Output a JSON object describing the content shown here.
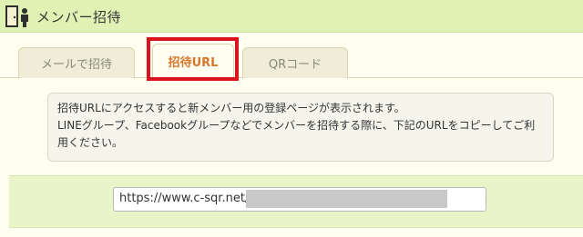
{
  "header": {
    "title": "メンバー招待",
    "icon": "door-person-icon"
  },
  "tabs": [
    {
      "label": "メールで招待",
      "active": false
    },
    {
      "label": "招待URL",
      "active": true
    },
    {
      "label": "QRコード",
      "active": false
    }
  ],
  "info": {
    "line1": "招待URLにアクセスすると新メンバー用の登録ページが表示されます。",
    "line2": "LINEグループ、Facebookグループなどでメンバーを招待する際に、下記のURLをコピーしてご利",
    "line3": "用ください。"
  },
  "invite_url": {
    "visible_text": "https://www.c-sqr.net/?"
  },
  "colors": {
    "header_bg": "#dff2b4",
    "active_tab_text": "#d8762c",
    "highlight_border": "#d9141f",
    "url_section_bg": "#e9f5c9"
  }
}
